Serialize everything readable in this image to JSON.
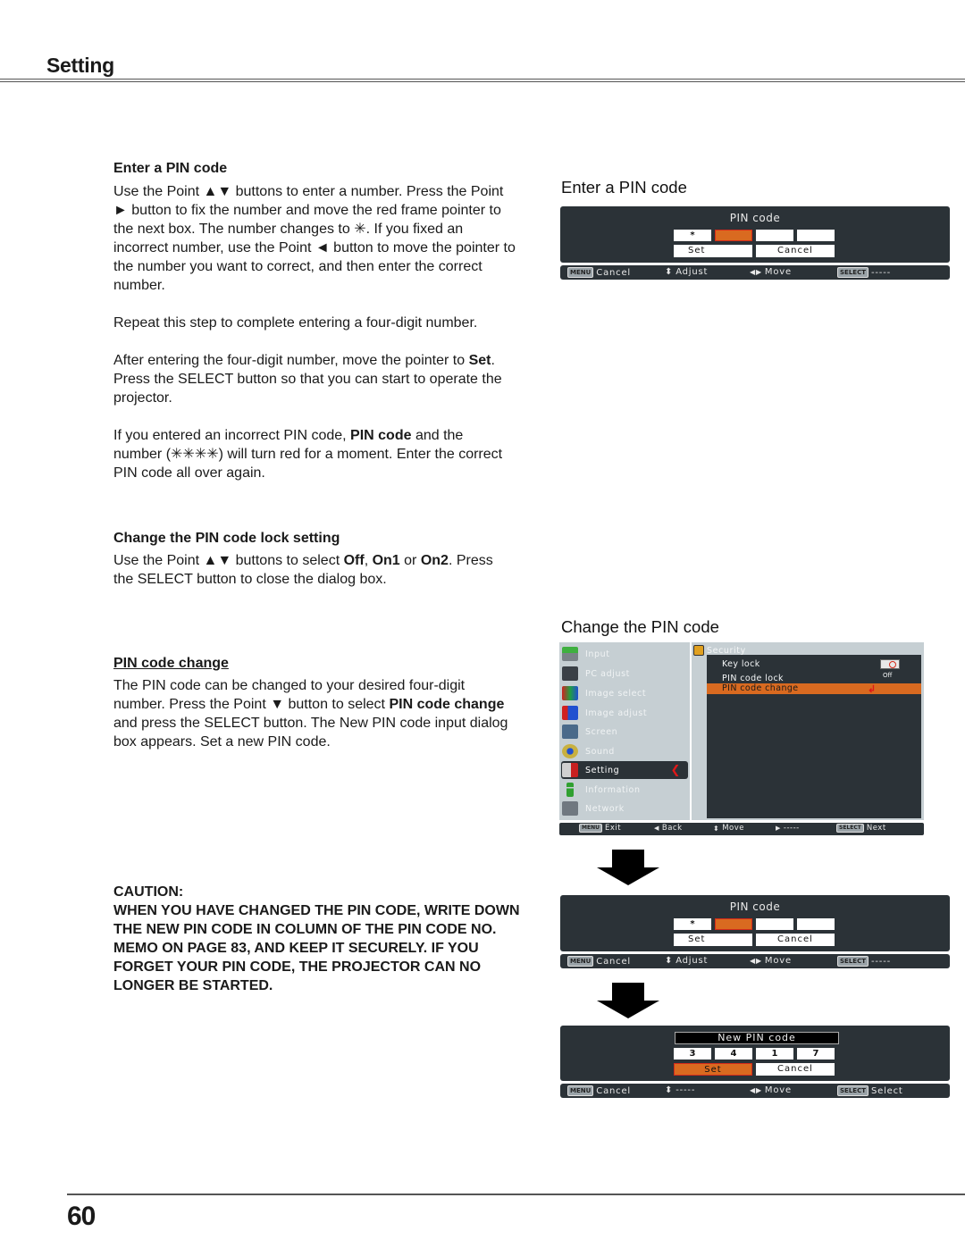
{
  "header": {
    "title": "Setting"
  },
  "left": {
    "enter_pin": {
      "heading": "Enter a PIN code",
      "para1": "Use the Point ▲▼  buttons to enter a number. Press the Point ► button to fix the number and move the red frame pointer to the next box. The number changes to ✳. If you fixed an incorrect number, use the Point ◄ button to move the pointer to the number you want to correct, and then enter the correct number.",
      "para2": "Repeat this step to complete entering a four-digit number.",
      "para3_a": "After entering the four-digit number, move the pointer to ",
      "para3_bold": "Set",
      "para3_b": ". Press the SELECT button so that you can start to operate the projector.",
      "para4_a": "If you entered an incorrect PIN code, ",
      "para4_bold": "PIN code",
      "para4_b": " and the number (✳✳✳✳) will turn red for a moment. Enter the correct PIN code all over again."
    },
    "change_lock": {
      "heading": "Change the PIN code lock setting",
      "para_a": "Use the Point ▲▼ buttons to select ",
      "opt1": "Off",
      "sep1": ", ",
      "opt2": "On1",
      "sep2": " or ",
      "opt3": "On2",
      "para_b": ". Press the SELECT button to close the dialog box."
    },
    "pin_change": {
      "heading": "PIN code change ",
      "para_a": "The PIN code can be changed to your desired four-digit number. Press the Point ▼ button to select ",
      "para_bold": "PIN code change",
      "para_b": " and press the SELECT button. The New PIN code input dialog box appears. Set a new PIN code."
    },
    "caution": {
      "label": "CAUTION:",
      "text": "WHEN YOU HAVE CHANGED THE PIN CODE, WRITE DOWN THE NEW PIN CODE IN COLUMN OF THE PIN CODE NO. MEMO ON PAGE 83, AND KEEP IT SECURELY. IF YOU FORGET YOUR PIN CODE, THE PROJECTOR CAN NO LONGER BE STARTED."
    }
  },
  "figures": {
    "enter_title": "Enter a PIN code",
    "change_title": "Change the PIN code",
    "pin_dialog": {
      "title": "PIN code",
      "digits": [
        "*",
        "",
        "",
        ""
      ],
      "set_label": "Set",
      "cancel_label": "Cancel",
      "bar": {
        "menu_key": "MENU",
        "menu_label": "Cancel",
        "updown_glyph": "⬍",
        "updown_label": "Adjust",
        "leftright_glyph": "◀▶",
        "leftright_label": "Move",
        "select_key": "SELECT",
        "select_label": "-----"
      }
    },
    "menu_screen": {
      "items": [
        {
          "label": "Input",
          "icon": "input-icon"
        },
        {
          "label": "PC adjust",
          "icon": "pc-adjust-icon"
        },
        {
          "label": "Image select",
          "icon": "image-select-icon"
        },
        {
          "label": "Image adjust",
          "icon": "image-adjust-icon"
        },
        {
          "label": "Screen",
          "icon": "screen-icon"
        },
        {
          "label": "Sound",
          "icon": "sound-icon"
        },
        {
          "label": "Setting",
          "icon": "setting-icon"
        },
        {
          "label": "Information",
          "icon": "information-icon"
        },
        {
          "label": "Network",
          "icon": "network-icon"
        }
      ],
      "selected_chevron": "❮",
      "submenu_title": "Security",
      "submenu": [
        {
          "label": "Key lock",
          "value": ""
        },
        {
          "label": "PIN code lock",
          "value": "Off"
        },
        {
          "label": "PIN code change",
          "value": "↲"
        }
      ],
      "bar": {
        "menu_key": "MENU",
        "menu_label": "Exit",
        "back_glyph": "◀",
        "back_label": "Back",
        "move_glyph": "⬍",
        "move_label": "Move",
        "right_glyph": "▶",
        "right_label": "-----",
        "select_key": "SELECT",
        "select_label": "Next"
      }
    },
    "new_pin_dialog": {
      "title": "New PIN code",
      "digits": [
        "3",
        "4",
        "1",
        "7"
      ],
      "set_label": "Set",
      "cancel_label": "Cancel",
      "bar": {
        "menu_key": "MENU",
        "menu_label": "Cancel",
        "updown_glyph": "⬍",
        "updown_label": "-----",
        "leftright_glyph": "◀▶",
        "leftright_label": "Move",
        "select_key": "SELECT",
        "select_label": "Select"
      }
    }
  },
  "footer": {
    "page_number": "60"
  }
}
